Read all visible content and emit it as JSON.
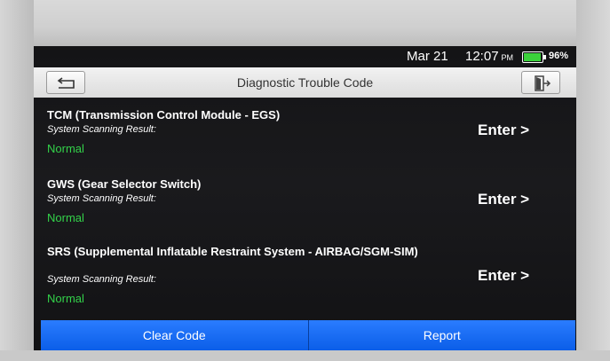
{
  "status_bar": {
    "date": "Mar 21",
    "time": "12:07",
    "ampm": "PM",
    "battery_pct": "96%",
    "battery_level": 0.96
  },
  "header": {
    "title": "Diagnostic Trouble Code",
    "back_icon": "back-arrow-icon",
    "exit_icon": "exit-icon"
  },
  "rows": [
    {
      "name": "TCM (Transmission Control Module - EGS)",
      "sub": "System Scanning Result:",
      "status": "Normal",
      "action": "Enter >"
    },
    {
      "name": "GWS (Gear Selector Switch)",
      "sub": "System Scanning Result:",
      "status": "Normal",
      "action": "Enter >"
    },
    {
      "name": "SRS (Supplemental Inflatable Restraint System - AIRBAG/SGM-SIM)",
      "sub": "System Scanning Result:",
      "status": "Normal",
      "action": "Enter >"
    }
  ],
  "bottom": {
    "clear_code": "Clear Code",
    "report": "Report"
  },
  "colors": {
    "accent": "#1a6cf5",
    "normal": "#33d24a",
    "battery": "#3bd23b"
  }
}
